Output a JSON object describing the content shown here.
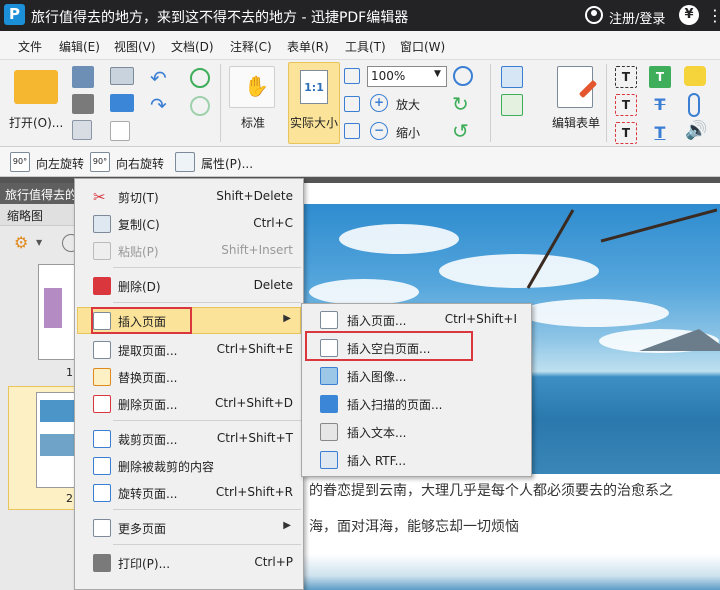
{
  "titlebar": {
    "title": "旅行值得去的地方，来到这不得不去的地方 - 迅捷PDF编辑器",
    "login": "注册/登录",
    "logo_letter": "P"
  },
  "menubar": {
    "items": [
      "文件",
      "编辑(E)",
      "视图(V)",
      "文档(D)",
      "注释(C)",
      "表单(R)",
      "工具(T)",
      "窗口(W)"
    ]
  },
  "ribbon": {
    "open_label": "打开(O)...",
    "standard_label": "标准",
    "actual_size_label": "实际大小",
    "actual_size_icon_text": "1:1",
    "zoom_value": "100%",
    "zoom_in_label": "放大",
    "zoom_out_label": "缩小",
    "edit_form_label": "编辑表单"
  },
  "subtoolbar": {
    "rotate_left": "向左旋转",
    "rotate_right": "向右旋转",
    "properties": "属性(P)..."
  },
  "document": {
    "tab_title": "旅行值得去的地方",
    "thumbnail_header": "缩略图",
    "thumb_page_1": "1",
    "thumb_page_2": "2",
    "paragraph_1": "的眷恋提到云南，大理几乎是每个人都必须要去的治愈系之",
    "paragraph_2": "海，面对洱海，能够忘却一切烦恼"
  },
  "context_menu": {
    "items": [
      {
        "label": "剪切(T)",
        "shortcut": "Shift+Delete"
      },
      {
        "label": "复制(C)",
        "shortcut": "Ctrl+C"
      },
      {
        "label": "粘贴(P)",
        "shortcut": "Shift+Insert"
      },
      {
        "label": "删除(D)",
        "shortcut": "Delete"
      },
      {
        "label": "插入页面",
        "shortcut": ""
      },
      {
        "label": "提取页面...",
        "shortcut": "Ctrl+Shift+E"
      },
      {
        "label": "替换页面...",
        "shortcut": ""
      },
      {
        "label": "删除页面...",
        "shortcut": "Ctrl+Shift+D"
      },
      {
        "label": "裁剪页面...",
        "shortcut": "Ctrl+Shift+T"
      },
      {
        "label": "删除被裁剪的内容",
        "shortcut": ""
      },
      {
        "label": "旋转页面...",
        "shortcut": "Ctrl+Shift+R"
      },
      {
        "label": "更多页面",
        "shortcut": ""
      },
      {
        "label": "打印(P)...",
        "shortcut": "Ctrl+P"
      }
    ]
  },
  "submenu": {
    "items": [
      {
        "label": "插入页面...",
        "shortcut": "Ctrl+Shift+I"
      },
      {
        "label": "插入空白页面...",
        "shortcut": ""
      },
      {
        "label": "插入图像...",
        "shortcut": ""
      },
      {
        "label": "插入扫描的页面...",
        "shortcut": ""
      },
      {
        "label": "插入文本...",
        "shortcut": ""
      },
      {
        "label": "插入 RTF...",
        "shortcut": ""
      }
    ]
  },
  "colors": {
    "titlebar": "#232325",
    "highlight": "#fbe39a",
    "annotation_red": "#d9363e"
  }
}
